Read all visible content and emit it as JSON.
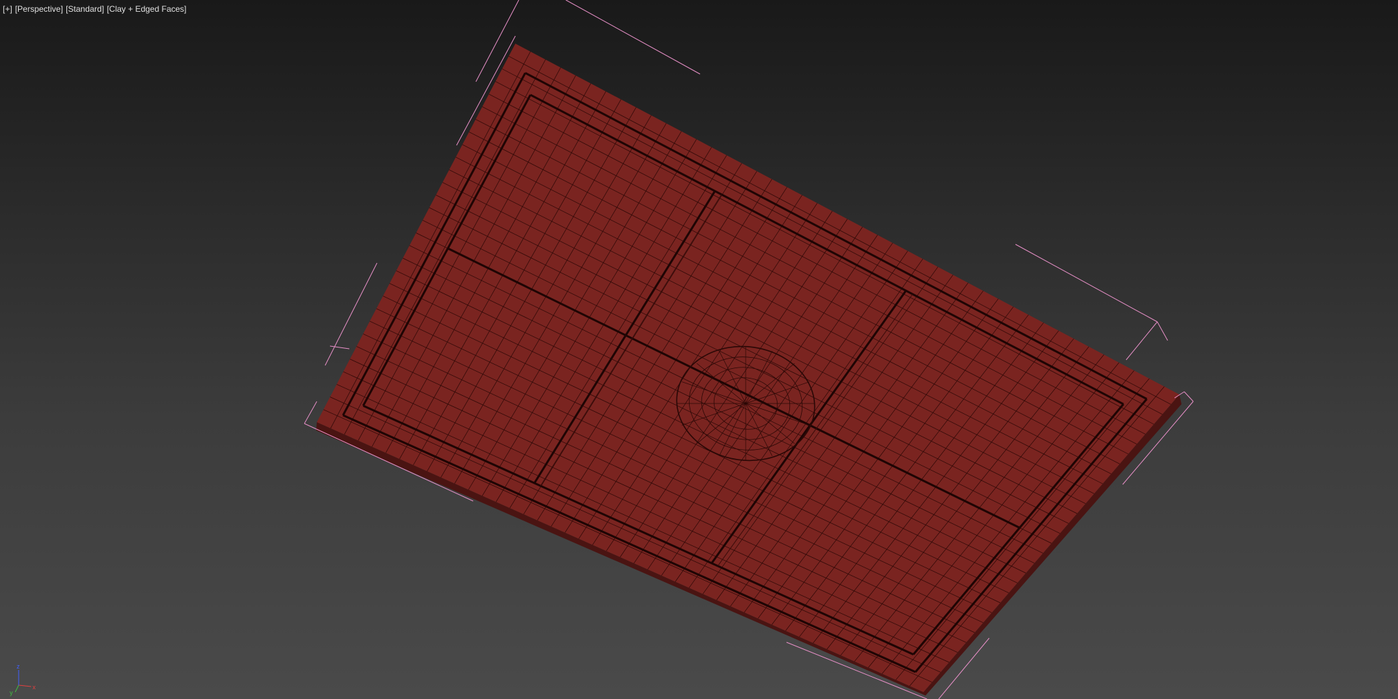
{
  "viewport": {
    "labels": [
      "[+]",
      "[Perspective]",
      "[Standard]",
      "[Clay + Edged Faces]"
    ]
  },
  "axis_gizmo": {
    "x_label": "x",
    "y_label": "y",
    "z_label": "z",
    "x_color": "#e04040",
    "y_color": "#40c040",
    "z_color": "#4060ff"
  },
  "scene": {
    "object_fill": "#7a2420",
    "object_side_fill": "#4a1412",
    "wire_color": "#2a0806",
    "bbox_color": "#e890c8"
  }
}
